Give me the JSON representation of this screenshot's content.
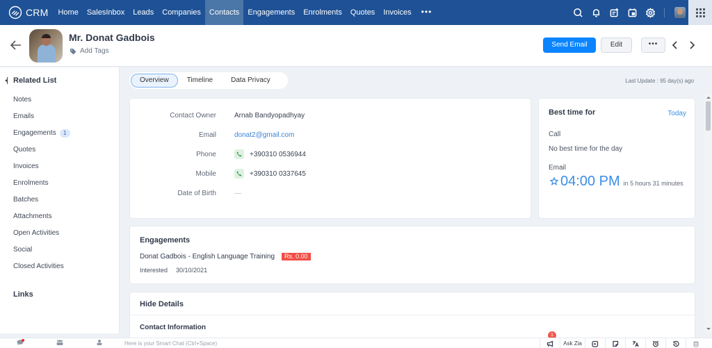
{
  "app": {
    "logo_text": "CRM"
  },
  "nav": {
    "items": [
      {
        "label": "Home",
        "active": false
      },
      {
        "label": "SalesInbox",
        "active": false
      },
      {
        "label": "Leads",
        "active": false
      },
      {
        "label": "Companies",
        "active": false
      },
      {
        "label": "Contacts",
        "active": true
      },
      {
        "label": "Engagements",
        "active": false
      },
      {
        "label": "Enrolments",
        "active": false
      },
      {
        "label": "Quotes",
        "active": false
      },
      {
        "label": "Invoices",
        "active": false
      }
    ],
    "more_label": "•••",
    "icons": [
      "search-icon",
      "bell-icon",
      "compose-icon",
      "calendar-icon",
      "settings-icon",
      "user-avatar",
      "apps-grid-icon"
    ]
  },
  "record": {
    "name": "Mr. Donat Gadbois",
    "add_tags_label": "Add Tags",
    "send_email_label": "Send Email",
    "edit_label": "Edit",
    "more_label": "•••"
  },
  "sidebar": {
    "title": "Related List",
    "items": [
      {
        "label": "Notes",
        "badge": null
      },
      {
        "label": "Emails",
        "badge": null
      },
      {
        "label": "Engagements",
        "badge": "1"
      },
      {
        "label": "Quotes",
        "badge": null
      },
      {
        "label": "Invoices",
        "badge": null
      },
      {
        "label": "Enrolments",
        "badge": null
      },
      {
        "label": "Batches",
        "badge": null
      },
      {
        "label": "Attachments",
        "badge": null
      },
      {
        "label": "Open Activities",
        "badge": null
      },
      {
        "label": "Social",
        "badge": null
      },
      {
        "label": "Closed Activities",
        "badge": null
      }
    ],
    "links_title": "Links"
  },
  "tabs": [
    {
      "label": "Overview",
      "active": true
    },
    {
      "label": "Timeline",
      "active": false
    },
    {
      "label": "Data Privacy",
      "active": false
    }
  ],
  "last_update": "Last Update : 95 day(s) ago",
  "contact_fields": [
    {
      "label": "Contact Owner",
      "value": "Arnab Bandyopadhyay",
      "type": "text"
    },
    {
      "label": "Email",
      "value": "donat2@gmail.com",
      "type": "link"
    },
    {
      "label": "Phone",
      "value": "+390310 0536944",
      "type": "phone"
    },
    {
      "label": "Mobile",
      "value": "+390310 0337645",
      "type": "phone"
    },
    {
      "label": "Date of Birth",
      "value": "—",
      "type": "empty"
    }
  ],
  "best_time": {
    "title": "Best time for",
    "day_selector": "Today",
    "call_label": "Call",
    "call_value": "No best time for the day",
    "email_label": "Email",
    "email_time": "04:00 PM",
    "email_relative": "in 5 hours 31 minutes"
  },
  "engagements": {
    "title": "Engagements",
    "item_name": "Donat Gadbois - English Language Training",
    "amount": "Rs. 0.00",
    "status": "Interested",
    "date": "30/10/2021"
  },
  "details": {
    "toggle_label": "Hide Details",
    "section_title": "Contact Information"
  },
  "bottom_bar": {
    "left_items": [
      {
        "label": "Chats",
        "has_dot": true
      },
      {
        "label": "Channels",
        "has_dot": false
      },
      {
        "label": "Contacts",
        "has_dot": false
      }
    ],
    "smart_chat_placeholder": "Here is your Smart Chat (Ctrl+Space)",
    "notification_count": "1",
    "ask_zia_label": "Ask Zia"
  }
}
